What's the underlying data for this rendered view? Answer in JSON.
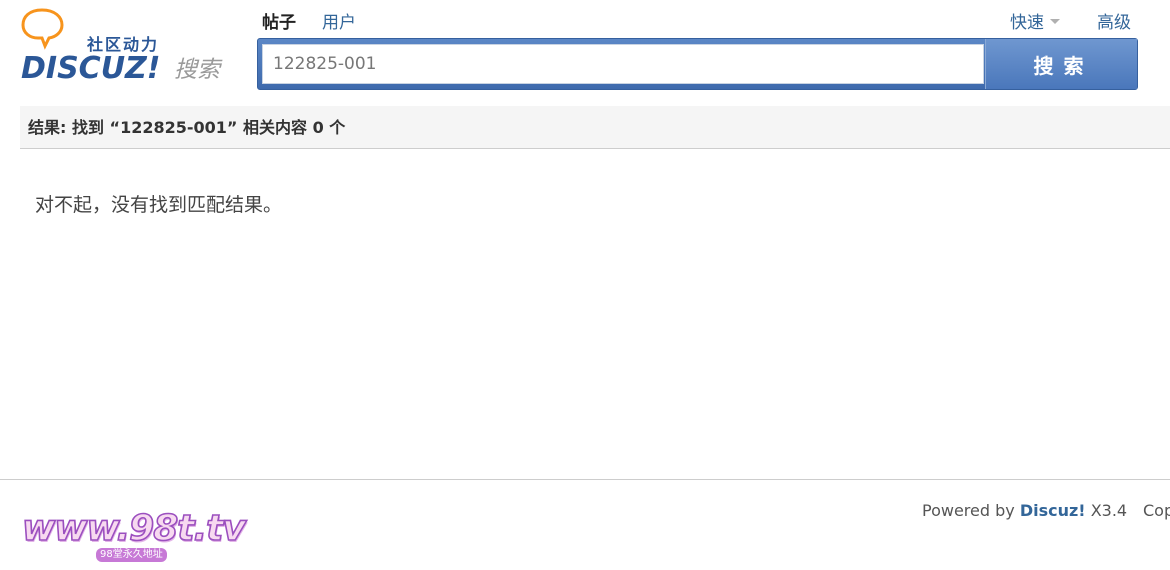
{
  "header": {
    "logo": {
      "tagline": "社区动力",
      "brand": "DISCUZ!",
      "product": "搜索",
      "bubble_color": "#f7941d",
      "brand_color": "#2b5797"
    },
    "search_types": [
      {
        "label": "帖子",
        "active": true
      },
      {
        "label": "用户",
        "active": false
      }
    ],
    "quick_label": "快速",
    "advanced_label": "高级",
    "search": {
      "value": "122825-001",
      "button_label": "搜索"
    }
  },
  "results": {
    "summary_prefix": "结果: 找到 ",
    "keyword": "“122825-001”",
    "summary_suffix": " 相关内容 0 个",
    "empty_message": "对不起，没有找到匹配结果。"
  },
  "footer": {
    "site_logo": {
      "text": "www.98t.tv",
      "subtext": "98堂永久地址"
    },
    "powered_by": "Powered by ",
    "powered_brand": "Discuz!",
    "version": " X3.4",
    "copyright": "Copyright"
  },
  "colors": {
    "accent": "#4a77bb",
    "link": "#336699"
  }
}
